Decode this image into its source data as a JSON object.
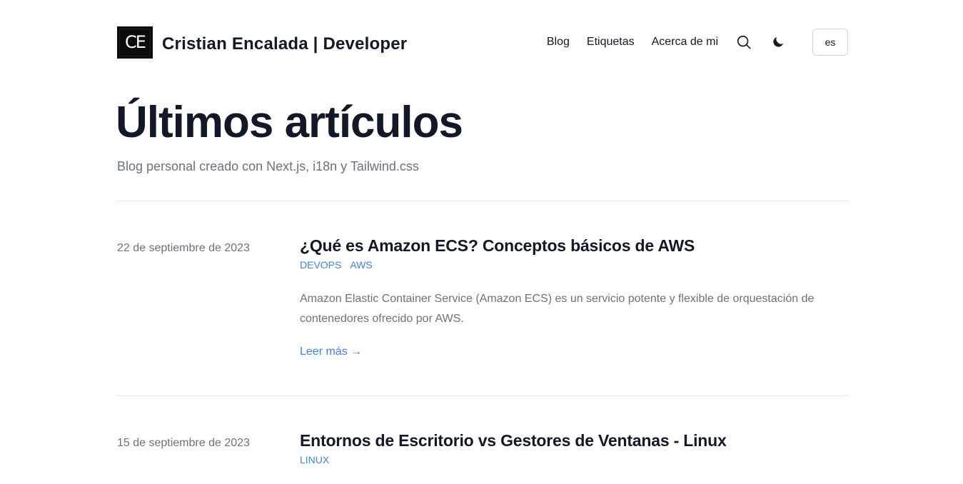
{
  "header": {
    "logo_text": "CE",
    "site_title": "Cristian Encalada | Developer",
    "nav": [
      "Blog",
      "Etiquetas",
      "Acerca de mi"
    ],
    "search_icon": "search-icon",
    "theme_icon": "moon-icon",
    "language": "es"
  },
  "hero": {
    "title": "Últimos artículos",
    "subtitle": "Blog personal creado con Next.js, i18n y Tailwind.css"
  },
  "posts": [
    {
      "date": "22 de septiembre de 2023",
      "title": "¿Qué es Amazon ECS? Conceptos básicos de AWS",
      "tags": [
        "DEVOPS",
        "AWS"
      ],
      "summary": "Amazon Elastic Container Service (Amazon ECS) es un servicio potente y flexible de orquestación de contenedores ofrecido por AWS.",
      "read_more": "Leer más →"
    },
    {
      "date": "15 de septiembre de 2023",
      "title": "Entornos de Escritorio vs Gestores de Ventanas - Linux",
      "tags": [
        "LINUX"
      ]
    }
  ],
  "colors": {
    "accent": "#3b82f6",
    "text": "#111827",
    "muted": "#6b7280",
    "border": "#e5e7eb"
  }
}
